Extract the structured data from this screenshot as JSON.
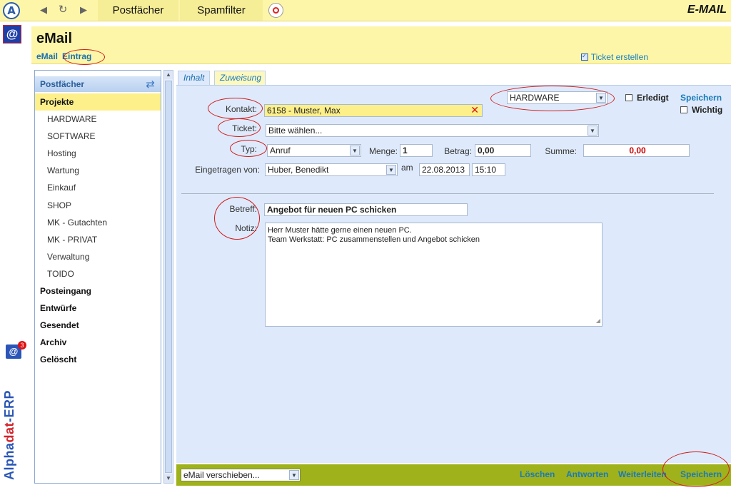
{
  "topbar": {
    "logo": "A",
    "nav": {
      "back": "◀",
      "reload": "↻",
      "forward": "▶"
    },
    "menu": [
      "Postfächer",
      "Spamfilter"
    ],
    "module_title": "E-MAIL"
  },
  "strip": {
    "email_icon": "@",
    "notifications_badge": "3",
    "brand": [
      "Alpha",
      "dat",
      "-ERP"
    ]
  },
  "header": {
    "title": "eMail",
    "breadcrumb": [
      "eMail",
      "Eintrag"
    ],
    "ticket_create": "Ticket erstellen"
  },
  "sidebar": {
    "title": "Postfächer",
    "items": [
      {
        "label": "Projekte",
        "level": "top",
        "selected": true
      },
      {
        "label": "HARDWARE",
        "level": "sub"
      },
      {
        "label": "SOFTWARE",
        "level": "sub"
      },
      {
        "label": "Hosting",
        "level": "sub"
      },
      {
        "label": "Wartung",
        "level": "sub"
      },
      {
        "label": "Einkauf",
        "level": "sub"
      },
      {
        "label": "SHOP",
        "level": "sub"
      },
      {
        "label": "MK - Gutachten",
        "level": "sub"
      },
      {
        "label": "MK - PRIVAT",
        "level": "sub"
      },
      {
        "label": "Verwaltung",
        "level": "sub"
      },
      {
        "label": "TOIDO",
        "level": "sub"
      },
      {
        "label": "Posteingang",
        "level": "top"
      },
      {
        "label": "Entwürfe",
        "level": "top"
      },
      {
        "label": "Gesendet",
        "level": "top"
      },
      {
        "label": "Archiv",
        "level": "top"
      },
      {
        "label": "Gelöscht",
        "level": "top"
      }
    ]
  },
  "tabs": [
    {
      "label": "Inhalt",
      "active": true
    },
    {
      "label": "Zuweisung",
      "active": false
    }
  ],
  "form": {
    "project_select": "HARDWARE",
    "erledigt_label": "Erledigt",
    "wichtig_label": "Wichtig",
    "save_top": "Speichern",
    "kontakt_label": "Kontakt:",
    "kontakt_value": "6158 - Muster, Max",
    "ticket_label": "Ticket:",
    "ticket_value": "Bitte wählen...",
    "typ_label": "Typ:",
    "typ_value": "Anruf",
    "menge_label": "Menge:",
    "menge_value": "1",
    "betrag_label": "Betrag:",
    "betrag_value": "0,00",
    "summe_label": "Summe:",
    "summe_value": "0,00",
    "eingetragen_label": "Eingetragen von:",
    "eingetragen_value": "Huber, Benedikt",
    "am_label": "am",
    "date_value": "22.08.2013",
    "time_value": "15:10",
    "betreff_label": "Betreff:",
    "betreff_value": "Angebot für neuen PC schicken",
    "notiz_label": "Notiz:",
    "notiz_lines": [
      "Herr Muster hätte gerne einen neuen PC.",
      "Team Werkstatt: PC zusammenstellen und Angebot schicken"
    ]
  },
  "footer": {
    "move_select": "eMail verschieben...",
    "actions": [
      "Löschen",
      "Antworten",
      "Weiterleiten",
      "Speichern"
    ]
  },
  "colors": {
    "header_yellow": "#fdf6a8",
    "content_blue": "#deeafb",
    "footer_green": "#9fb21c",
    "link_blue": "#1a7ab8",
    "annotation_red": "#d21b1b"
  }
}
